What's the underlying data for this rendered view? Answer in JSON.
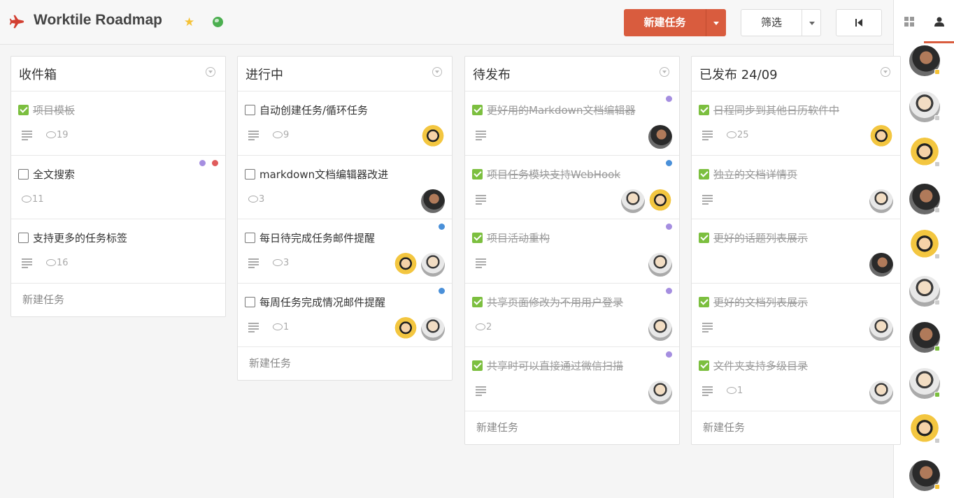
{
  "header": {
    "project_title": "Worktile Roadmap",
    "new_task_label": "新建任务",
    "filter_label": "筛选",
    "accent_color": "#d95c3e"
  },
  "icons": {
    "logo": "airplane-icon",
    "star": "star-icon",
    "visibility": "globe-icon",
    "collapse": "collapse-panel-icon",
    "grid_view": "grid-icon",
    "members_view": "user-icon"
  },
  "columns": [
    {
      "title": "收件箱",
      "add_task_label": "新建任务",
      "cards": [
        {
          "title": "项目模板",
          "done": true,
          "has_desc": true,
          "comments": "19",
          "tags": [],
          "avatars": []
        },
        {
          "title": "全文搜索",
          "done": false,
          "has_desc": false,
          "comments": "11",
          "tags": [
            "#a58ee0",
            "#e05c5c"
          ],
          "avatars": []
        },
        {
          "title": "支持更多的任务标签",
          "done": false,
          "has_desc": true,
          "comments": "16",
          "tags": [],
          "avatars": []
        }
      ]
    },
    {
      "title": "进行中",
      "add_task_label": "新建任务",
      "cards": [
        {
          "title": "自动创建任务/循环任务",
          "done": false,
          "has_desc": true,
          "comments": "9",
          "tags": [],
          "avatars": [
            "cartoon"
          ]
        },
        {
          "title": "markdown文档编辑器改进",
          "done": false,
          "has_desc": false,
          "comments": "3",
          "tags": [],
          "avatars": [
            "dark"
          ]
        },
        {
          "title": "每日待完成任务邮件提醒",
          "done": false,
          "has_desc": true,
          "comments": "3",
          "tags": [
            "#4a90d9"
          ],
          "avatars": [
            "cartoon",
            "profile"
          ]
        },
        {
          "title": "每周任务完成情况邮件提醒",
          "done": false,
          "has_desc": true,
          "comments": "1",
          "tags": [
            "#4a90d9"
          ],
          "avatars": [
            "cartoon",
            "profile"
          ]
        }
      ]
    },
    {
      "title": "待发布",
      "add_task_label": "新建任务",
      "cards": [
        {
          "title": "更好用的Markdown文档编辑器",
          "done": true,
          "has_desc": true,
          "comments": "",
          "tags": [
            "#a58ee0"
          ],
          "avatars": [
            "dark"
          ]
        },
        {
          "title": "项目任务模块支持WebHook",
          "done": true,
          "has_desc": true,
          "comments": "",
          "tags": [
            "#4a90d9"
          ],
          "avatars": [
            "profile",
            "cartoon"
          ]
        },
        {
          "title": "项目活动重构",
          "done": true,
          "has_desc": true,
          "comments": "",
          "tags": [
            "#a58ee0"
          ],
          "avatars": [
            "profile"
          ]
        },
        {
          "title": "共享页面修改为不用用户登录",
          "done": true,
          "has_desc": false,
          "comments": "2",
          "tags": [
            "#a58ee0"
          ],
          "avatars": [
            "profile"
          ]
        },
        {
          "title": "共享时可以直接通过微信扫描",
          "done": true,
          "has_desc": true,
          "comments": "",
          "tags": [
            "#a58ee0"
          ],
          "avatars": [
            "profile"
          ]
        }
      ]
    },
    {
      "title": "已发布 24/09",
      "add_task_label": "新建任务",
      "cards": [
        {
          "title": "日程同步到其他日历软件中",
          "done": true,
          "has_desc": true,
          "comments": "25",
          "tags": [],
          "avatars": [
            "cartoon"
          ]
        },
        {
          "title": "独立的文档详情页",
          "done": true,
          "has_desc": true,
          "comments": "",
          "tags": [],
          "avatars": [
            "profile"
          ]
        },
        {
          "title": "更好的话题列表展示",
          "done": true,
          "has_desc": false,
          "comments": "",
          "tags": [],
          "avatars": [
            "dark"
          ]
        },
        {
          "title": "更好的文档列表展示",
          "done": true,
          "has_desc": true,
          "comments": "",
          "tags": [],
          "avatars": [
            "profile"
          ]
        },
        {
          "title": "文件夹支持多级目录",
          "done": true,
          "has_desc": true,
          "comments": "1",
          "tags": [],
          "avatars": [
            "profile"
          ]
        }
      ]
    }
  ],
  "members": [
    {
      "avatar": "dark",
      "status_color": "#f5c237"
    },
    {
      "avatar": "profile",
      "status_color": "#cccccc"
    },
    {
      "avatar": "cartoon",
      "status_color": "#cccccc"
    },
    {
      "avatar": "dark",
      "status_color": "#cccccc"
    },
    {
      "avatar": "cartoon",
      "status_color": "#cccccc"
    },
    {
      "avatar": "profile",
      "status_color": "#cccccc"
    },
    {
      "avatar": "dark",
      "status_color": "#7cbf3f"
    },
    {
      "avatar": "profile",
      "status_color": "#7cbf3f"
    },
    {
      "avatar": "cartoon",
      "status_color": "#cccccc"
    },
    {
      "avatar": "dark",
      "status_color": "#f5c237"
    }
  ]
}
